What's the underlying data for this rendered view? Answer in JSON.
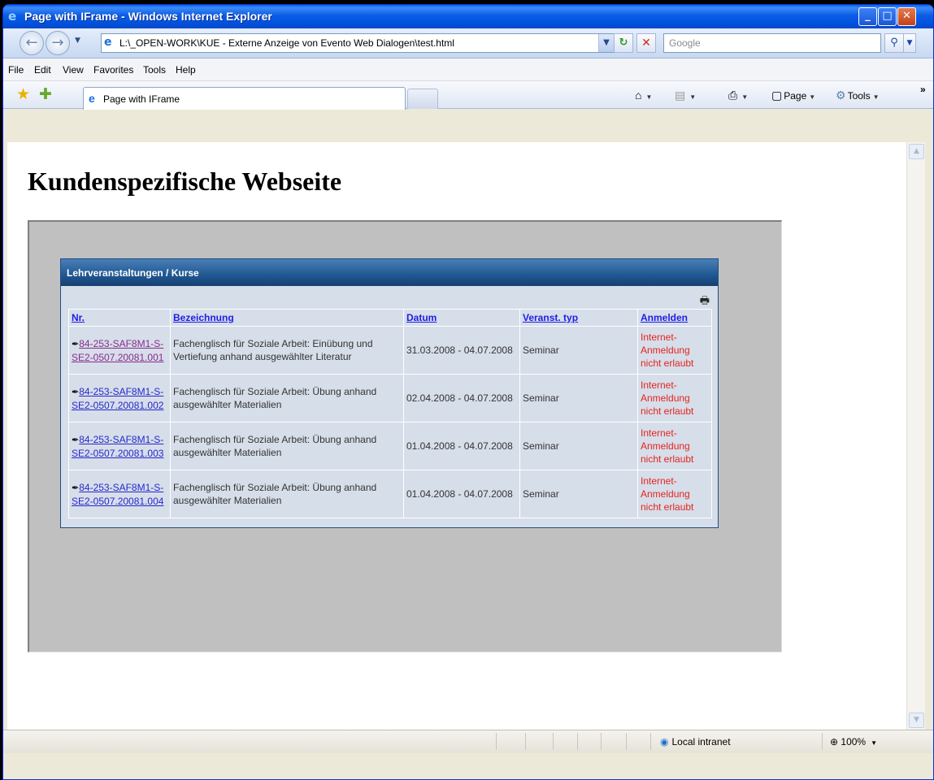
{
  "window": {
    "title": "Page with IFrame - Windows Internet Explorer",
    "buttons": {
      "minimize": "_",
      "maximize": "□",
      "close": "✕"
    }
  },
  "address": {
    "url": "L:\\_OPEN-WORK\\KUE - Externe Anzeige von Evento Web Dialogen\\test.html",
    "search_placeholder": "Google"
  },
  "menu": [
    "File",
    "Edit",
    "View",
    "Favorites",
    "Tools",
    "Help"
  ],
  "tabs": [
    {
      "label": "Page with IFrame"
    }
  ],
  "commands": {
    "page": "Page",
    "tools": "Tools",
    "more": "»"
  },
  "page": {
    "heading": "Kundenspezifische Webseite",
    "panel_title": "Lehrveranstaltungen / Kurse",
    "columns": [
      "Nr.",
      "Bezeichnung",
      "Datum",
      "Veranst. typ",
      "Anmelden"
    ],
    "rows": [
      {
        "nr": "84-253-SAF8M1-S-SE2-0507.20081.001",
        "bezeichnung": "Fachenglisch für Soziale Arbeit: Einübung und Vertiefung anhand ausgewählter Literatur",
        "datum": "31.03.2008 - 04.07.2008",
        "typ": "Seminar",
        "anmelden": "Internet-Anmeldung nicht erlaubt"
      },
      {
        "nr": "84-253-SAF8M1-S-SE2-0507.20081.002",
        "bezeichnung": "Fachenglisch für Soziale Arbeit: Übung anhand ausgewählter Materialien",
        "datum": "02.04.2008 - 04.07.2008",
        "typ": "Seminar",
        "anmelden": "Internet-Anmeldung nicht erlaubt"
      },
      {
        "nr": "84-253-SAF8M1-S-SE2-0507.20081.003",
        "bezeichnung": "Fachenglisch für Soziale Arbeit: Übung anhand ausgewählter Materialien",
        "datum": "01.04.2008 - 04.07.2008",
        "typ": "Seminar",
        "anmelden": "Internet-Anmeldung nicht erlaubt"
      },
      {
        "nr": "84-253-SAF8M1-S-SE2-0507.20081.004",
        "bezeichnung": "Fachenglisch für Soziale Arbeit: Übung anhand ausgewählter Materialien",
        "datum": "01.04.2008 - 04.07.2008",
        "typ": "Seminar",
        "anmelden": "Internet-Anmeldung nicht erlaubt"
      }
    ]
  },
  "status": {
    "zone": "Local intranet",
    "zoom": "100%"
  },
  "colors": {
    "link": "#2828cc",
    "visited": "#8a2b8e",
    "denied": "#e6241f",
    "panel_header": "#1f5792"
  }
}
